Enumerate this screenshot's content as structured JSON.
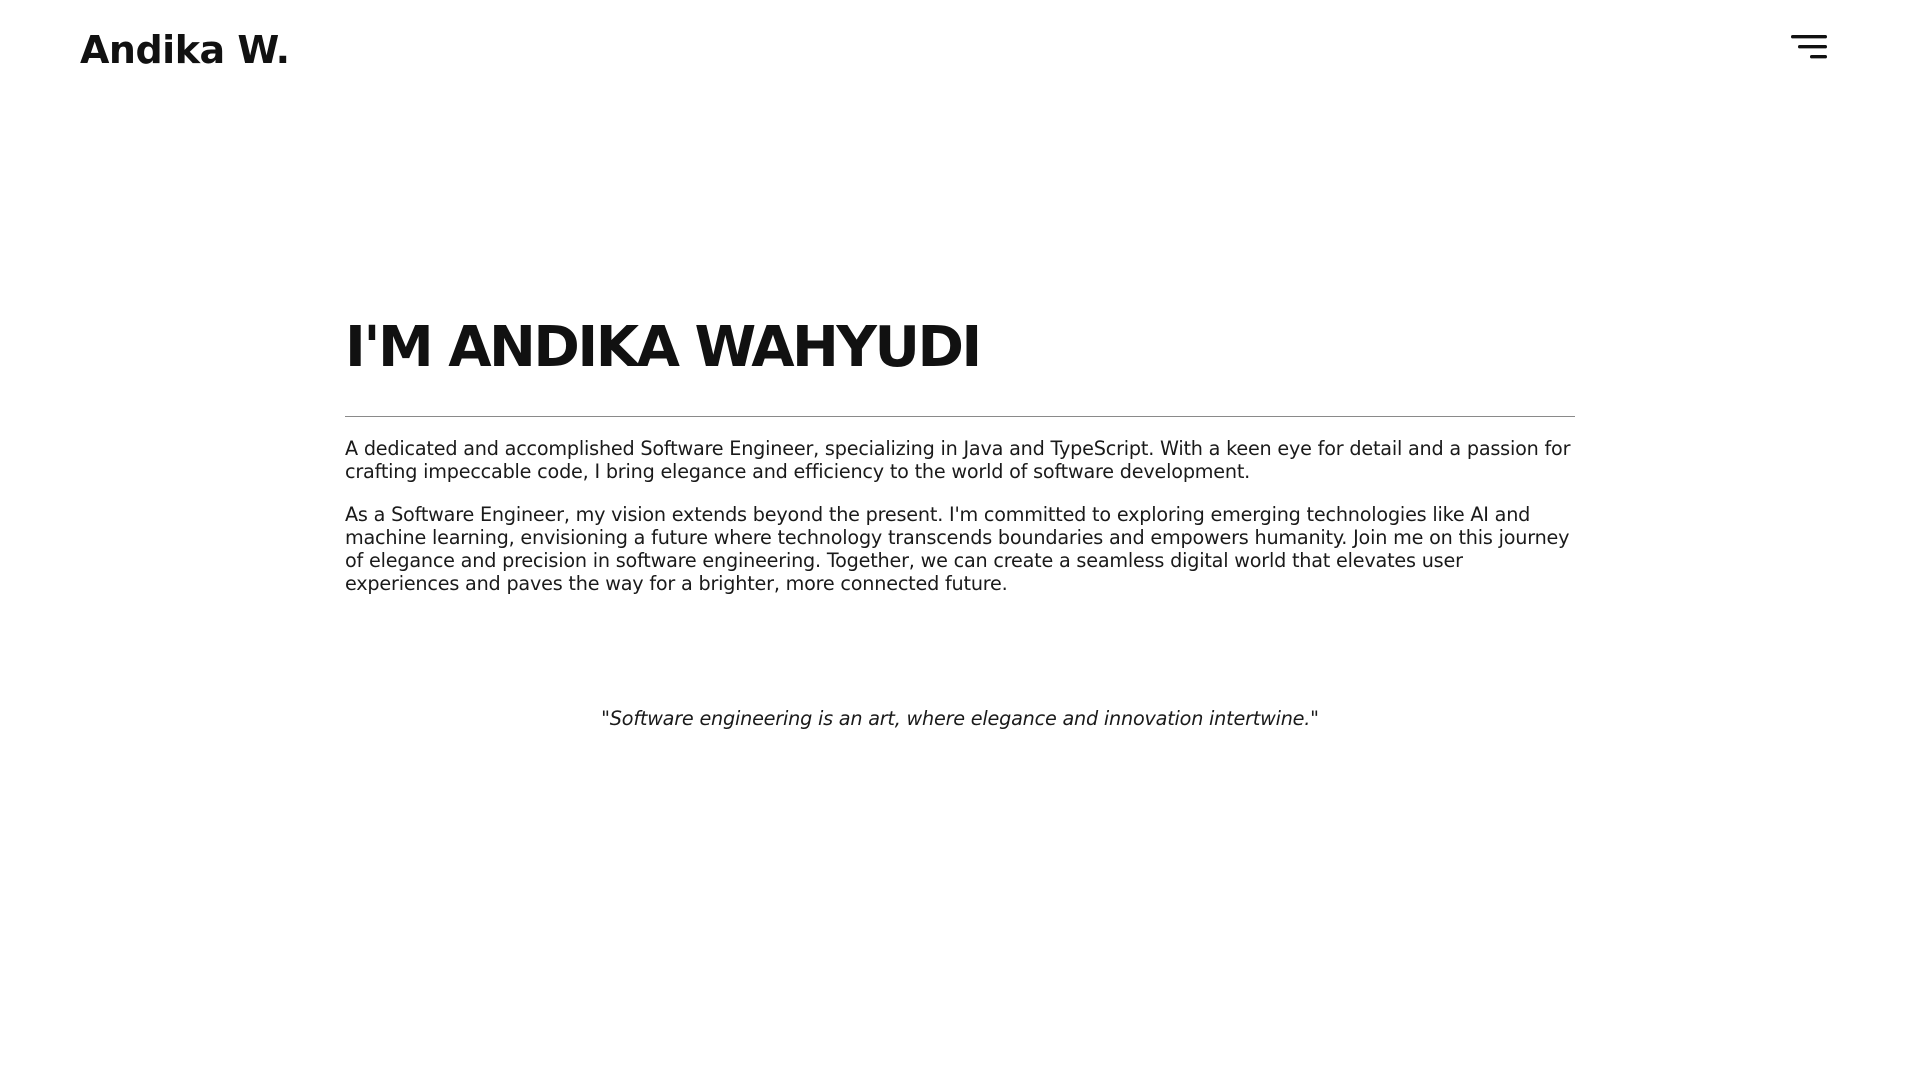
{
  "header": {
    "brand": "Andika W.",
    "menu_icon": "hamburger-menu-icon"
  },
  "main": {
    "title": "I'M ANDIKA WAHYUDI",
    "paragraphs": [
      "A dedicated and accomplished Software Engineer, specializing in Java and TypeScript. With a keen eye for detail and a passion for crafting impeccable code, I bring elegance and efficiency to the world of software development.",
      "As a Software Engineer, my vision extends beyond the present. I'm committed to exploring emerging technologies like AI and machine learning, envisioning a future where technology transcends boundaries and empowers humanity. Join me on this journey of elegance and precision in software engineering. Together, we can create a seamless digital world that elevates user experiences and paves the way for a brighter, more connected future."
    ],
    "quote": "\"Software engineering is an art, where elegance and innovation intertwine.\""
  },
  "colors": {
    "background": "#ffffff",
    "text": "#111111",
    "divider": "#8a8a8a"
  }
}
